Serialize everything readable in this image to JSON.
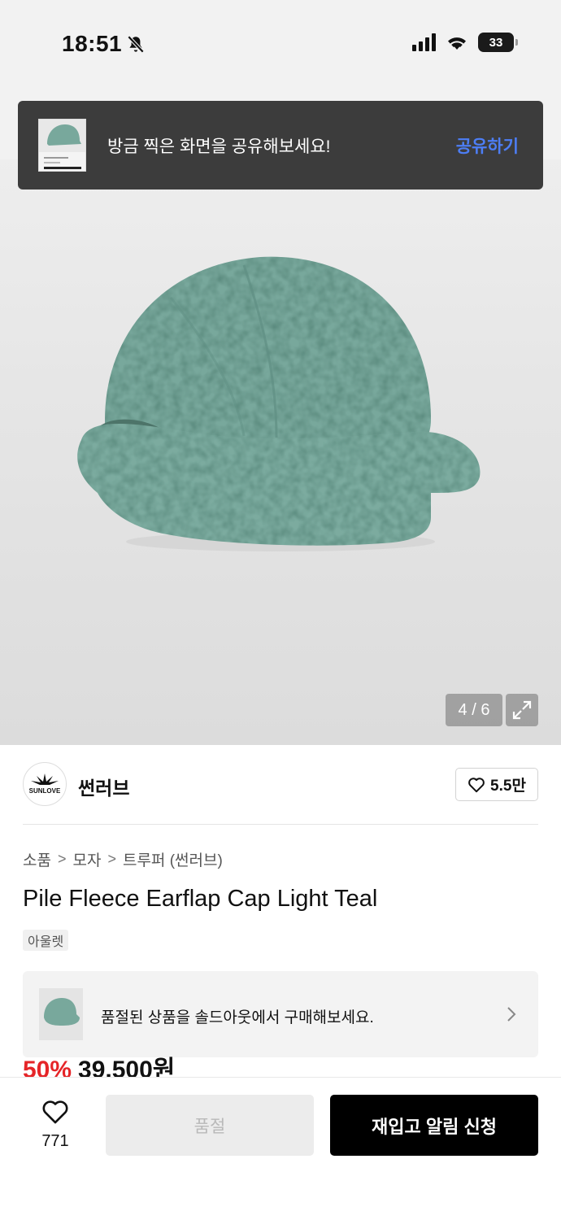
{
  "status": {
    "time": "18:51",
    "battery": "33"
  },
  "toast": {
    "message": "방금 찍은 화면을 공유해보세요!",
    "action": "공유하기"
  },
  "gallery": {
    "counter": "4 / 6"
  },
  "brand": {
    "name": "썬러브",
    "logo_text": "SUNLOVE",
    "likes": "5.5만"
  },
  "breadcrumb": [
    "소품",
    "모자",
    "트루퍼 (썬러브)"
  ],
  "product": {
    "title": "Pile Fleece Earflap Cap Light Teal",
    "tag": "아울렛"
  },
  "banner": {
    "text": "품절된 상품을 솔드아웃에서 구매해보세요."
  },
  "price": {
    "discount": "50%",
    "amount": "39,500원"
  },
  "bottom": {
    "wish_count": "771",
    "soldout_label": "품절",
    "restock_label": "재입고 알림 신청"
  },
  "colors": {
    "accent_blue": "#4d7ef5",
    "discount_red": "#e52528",
    "hat_teal": "#78a89c"
  }
}
